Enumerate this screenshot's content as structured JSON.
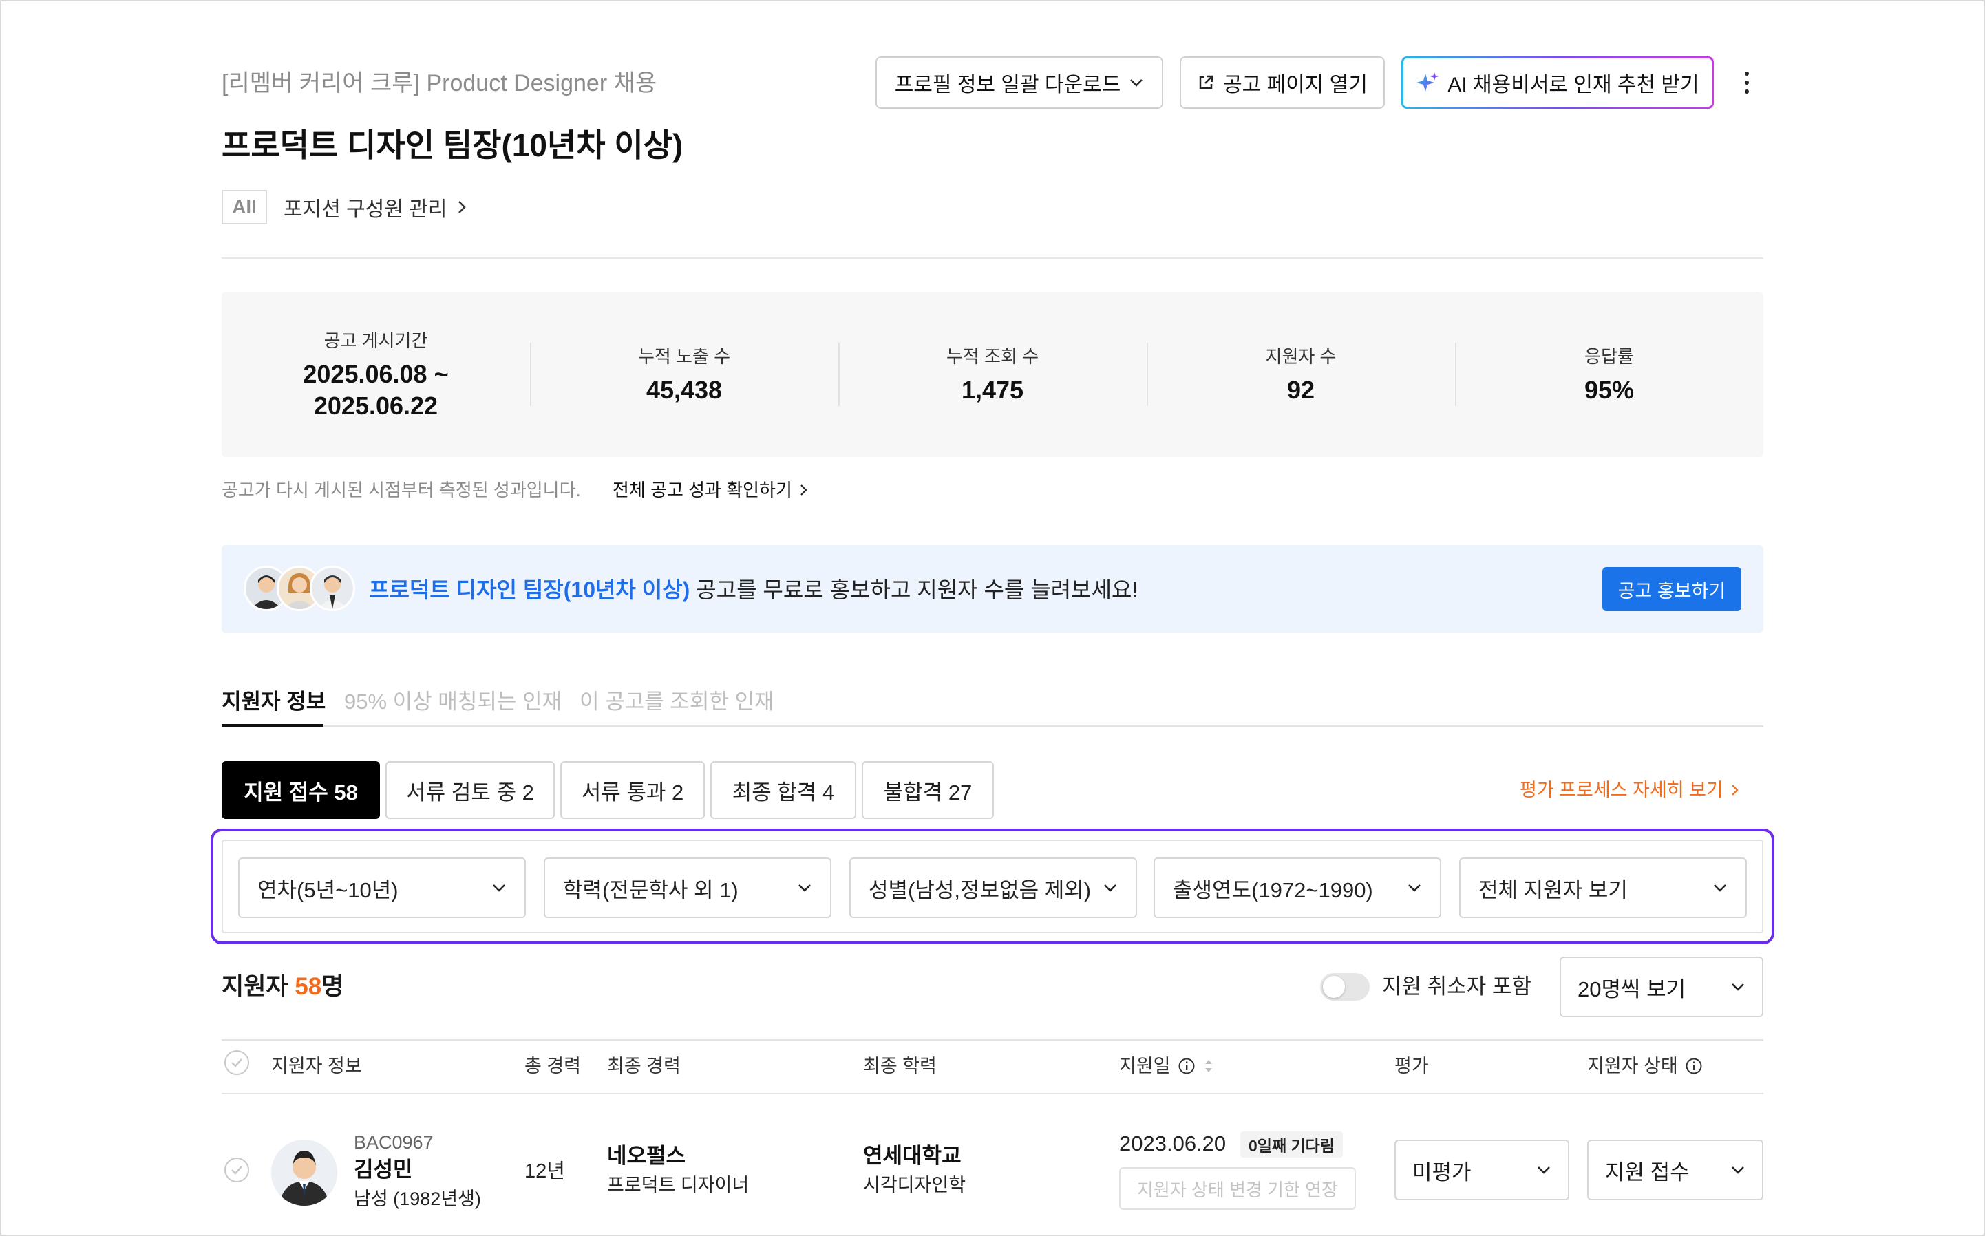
{
  "header": {
    "subtitle": "[리멤버 커리어 크루] Product Designer 채용",
    "title": "프로덕트 디자인 팀장(10년차 이상)",
    "all_badge": "All",
    "position_link": "포지션 구성원 관리"
  },
  "toolbar": {
    "download_label": "프로필 정보 일괄 다운로드",
    "open_label": "공고 페이지 열기",
    "ai_label": "AI 채용비서로 인재 추천 받기"
  },
  "stats": [
    {
      "label": "공고 게시기간",
      "value": "2025.06.08 ~\n2025.06.22"
    },
    {
      "label": "누적 노출 수",
      "value": "45,438"
    },
    {
      "label": "누적 조회 수",
      "value": "1,475"
    },
    {
      "label": "지원자 수",
      "value": "92"
    },
    {
      "label": "응답률",
      "value": "95%"
    }
  ],
  "note": {
    "text": "공고가 다시 게시된 시점부터 측정된 성과입니다.",
    "link": "전체 공고 성과 확인하기"
  },
  "promo": {
    "highlight": "프로덕트 디자인 팀장(10년차 이상)",
    "text": " 공고를 무료로 홍보하고 지원자 수를 늘려보세요!",
    "button": "공고 홍보하기"
  },
  "tabs": [
    {
      "label": "지원자 정보",
      "active": true
    },
    {
      "label": "95% 이상 매칭되는 인재",
      "active": false
    },
    {
      "label": "이 공고를 조회한 인재",
      "active": false
    }
  ],
  "status_pills": [
    {
      "label": "지원 접수 58",
      "active": true
    },
    {
      "label": "서류 검토 중 2",
      "active": false
    },
    {
      "label": "서류 통과 2",
      "active": false
    },
    {
      "label": "최종 합격 4",
      "active": false
    },
    {
      "label": "불합격 27",
      "active": false
    }
  ],
  "eval_link": "평가 프로세스 자세히 보기",
  "filters": [
    {
      "label": "연차(5년~10년)"
    },
    {
      "label": "학력(전문학사 외 1)"
    },
    {
      "label": "성별(남성,정보없음 제외)"
    },
    {
      "label": "출생연도(1972~1990)"
    },
    {
      "label": "전체 지원자 보기"
    }
  ],
  "count": {
    "prefix": "지원자 ",
    "number": "58",
    "suffix": "명"
  },
  "toggle_label": "지원 취소자 포함",
  "per_page": "20명씩 보기",
  "table": {
    "headers": {
      "applicant": "지원자 정보",
      "total_career": "총 경력",
      "last_career": "최종 경력",
      "last_edu": "최종 학력",
      "applied_date": "지원일",
      "evaluation": "평가",
      "status": "지원자 상태"
    },
    "rows": [
      {
        "id": "BAC0967",
        "name": "김성민",
        "info": "남성 (1982년생)",
        "total_career": "12년",
        "company": "네오펄스",
        "role": "프로덕트 디자이너",
        "school": "연세대학교",
        "major": "시각디자인학",
        "date": "2023.06.20",
        "wait": "0일째 기다림",
        "extend": "지원자 상태 변경 기한 연장",
        "evaluation": "미평가",
        "status": "지원 접수"
      }
    ]
  },
  "colors": {
    "accent_blue": "#1a73e8",
    "accent_orange": "#f26b1d",
    "filter_border": "#6b2ee8"
  }
}
